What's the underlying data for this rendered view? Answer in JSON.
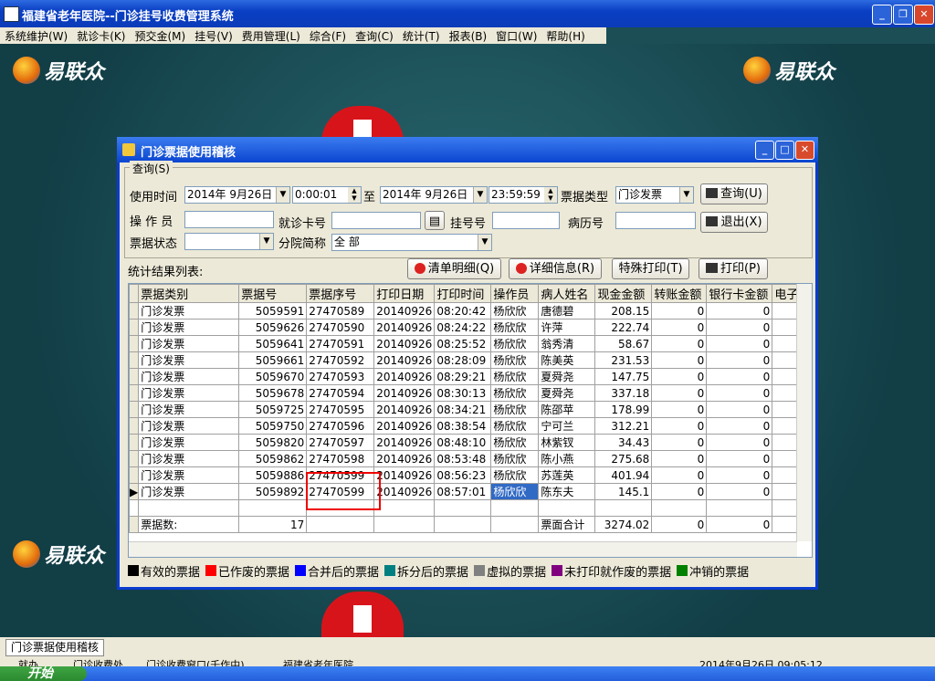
{
  "app": {
    "title": "福建省老年医院--门诊挂号收费管理系统"
  },
  "menu": [
    "系统维护(W)",
    "就诊卡(K)",
    "预交金(M)",
    "挂号(V)",
    "费用管理(L)",
    "综合(F)",
    "查询(C)",
    "统计(T)",
    "报表(B)",
    "窗口(W)",
    "帮助(H)"
  ],
  "brand": {
    "logo_text": "易联众"
  },
  "dialog": {
    "title": "门诊票据使用稽核",
    "query_group": "查询(S)",
    "use_time_label": "使用时间",
    "date_from": "2014年 9月26日",
    "time_from": "0:00:01",
    "to_label": "至",
    "date_to": "2014年 9月26日",
    "time_to": "23:59:59",
    "ticket_type_label": "票据类型",
    "ticket_type_value": "门诊发票",
    "query_button": "查询(U)",
    "operator_label": "操 作 员",
    "operator_value": "",
    "card_label": "就诊卡号",
    "card_value": "",
    "reg_label": "挂号号",
    "reg_value": "",
    "record_label": "病历号",
    "record_value": "",
    "exit_button": "退出(X)",
    "status_label": "票据状态",
    "status_value": "",
    "branch_label": "分院简称",
    "branch_value": "全 部",
    "result_label": "统计结果列表:",
    "clear_button": "清单明细(Q)",
    "detail_button": "详细信息(R)",
    "special_print_button": "特殊打印(T)",
    "print_button": "打印(P)"
  },
  "table": {
    "columns": [
      "票据类别",
      "票据号",
      "票据序号",
      "打印日期",
      "打印时间",
      "操作员",
      "病人姓名",
      "现金金额",
      "转账金额",
      "银行卡金额",
      "电子"
    ],
    "rows": [
      [
        "门诊发票",
        "5059591",
        "27470589",
        "20140926",
        "08:20:42",
        "杨欣欣",
        "唐德碧",
        "208.15",
        "0",
        "0"
      ],
      [
        "门诊发票",
        "5059626",
        "27470590",
        "20140926",
        "08:24:22",
        "杨欣欣",
        "许萍",
        "222.74",
        "0",
        "0"
      ],
      [
        "门诊发票",
        "5059641",
        "27470591",
        "20140926",
        "08:25:52",
        "杨欣欣",
        "翁秀清",
        "58.67",
        "0",
        "0"
      ],
      [
        "门诊发票",
        "5059661",
        "27470592",
        "20140926",
        "08:28:09",
        "杨欣欣",
        "陈美英",
        "231.53",
        "0",
        "0"
      ],
      [
        "门诊发票",
        "5059670",
        "27470593",
        "20140926",
        "08:29:21",
        "杨欣欣",
        "夏舜尧",
        "147.75",
        "0",
        "0"
      ],
      [
        "门诊发票",
        "5059678",
        "27470594",
        "20140926",
        "08:30:13",
        "杨欣欣",
        "夏舜尧",
        "337.18",
        "0",
        "0"
      ],
      [
        "门诊发票",
        "5059725",
        "27470595",
        "20140926",
        "08:34:21",
        "杨欣欣",
        "陈邵苹",
        "178.99",
        "0",
        "0"
      ],
      [
        "门诊发票",
        "5059750",
        "27470596",
        "20140926",
        "08:38:54",
        "杨欣欣",
        "宁可兰",
        "312.21",
        "0",
        "0"
      ],
      [
        "门诊发票",
        "5059820",
        "27470597",
        "20140926",
        "08:48:10",
        "杨欣欣",
        "林紫钗",
        "34.43",
        "0",
        "0"
      ],
      [
        "门诊发票",
        "5059862",
        "27470598",
        "20140926",
        "08:53:48",
        "杨欣欣",
        "陈小燕",
        "275.68",
        "0",
        "0"
      ],
      [
        "门诊发票",
        "5059886",
        "27470599",
        "20140926",
        "08:56:23",
        "杨欣欣",
        "苏莲英",
        "401.94",
        "0",
        "0"
      ],
      [
        "门诊发票",
        "5059892",
        "27470599",
        "20140926",
        "08:57:01",
        "杨欣欣",
        "陈东夫",
        "145.1",
        "0",
        "0"
      ]
    ],
    "summary": {
      "count_label": "票据数:",
      "count": "17",
      "total_label": "票面合计",
      "cash_total": "3274.02",
      "transfer_total": "0",
      "bank_total": "0"
    }
  },
  "legend": [
    {
      "label": "有效的票据",
      "color": "#000000"
    },
    {
      "label": "已作废的票据",
      "color": "#ff0000"
    },
    {
      "label": "合并后的票据",
      "color": "#0000ff"
    },
    {
      "label": "拆分后的票据",
      "color": "#008080"
    },
    {
      "label": "虚拟的票据",
      "color": "#808080"
    },
    {
      "label": "未打印就作废的票据",
      "color": "#800080"
    },
    {
      "label": "冲销的票据",
      "color": "#008000"
    }
  ],
  "statusbar": {
    "tab": "门诊票据使用稽核"
  },
  "bottom": [
    "就办",
    "门诊收费处",
    "门诊收费窗口(壬作中)",
    "福建省老年医院",
    "2014年9月26日 09:05:12"
  ],
  "taskbar": {
    "start": "开始"
  }
}
